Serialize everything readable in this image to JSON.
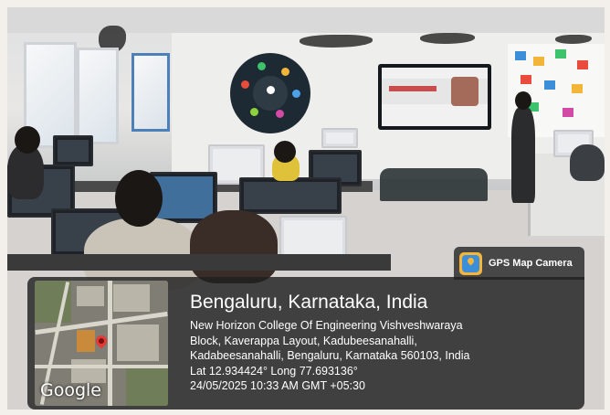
{
  "overlay": {
    "app_label": "GPS Map Camera",
    "app_icon": "gps-map-camera-icon",
    "map_brand": "Google",
    "location_title": "Bengaluru, Karnataka, India",
    "address_lines": [
      "New Horizon College Of Engineering Vishveshwaraya",
      "Block, Kaverappa Layout, Kadubeesanahalli,",
      "Kadabeesanahalli, Bengaluru, Karnataka 560103, India"
    ],
    "coordinates": "Lat 12.934424° Long 77.693136°",
    "timestamp": "24/05/2025 10:33 AM GMT +05:30"
  },
  "colors": {
    "panel_bg": "#202020",
    "pin": "#e53935",
    "app_icon_bg": "#f4b63a"
  }
}
